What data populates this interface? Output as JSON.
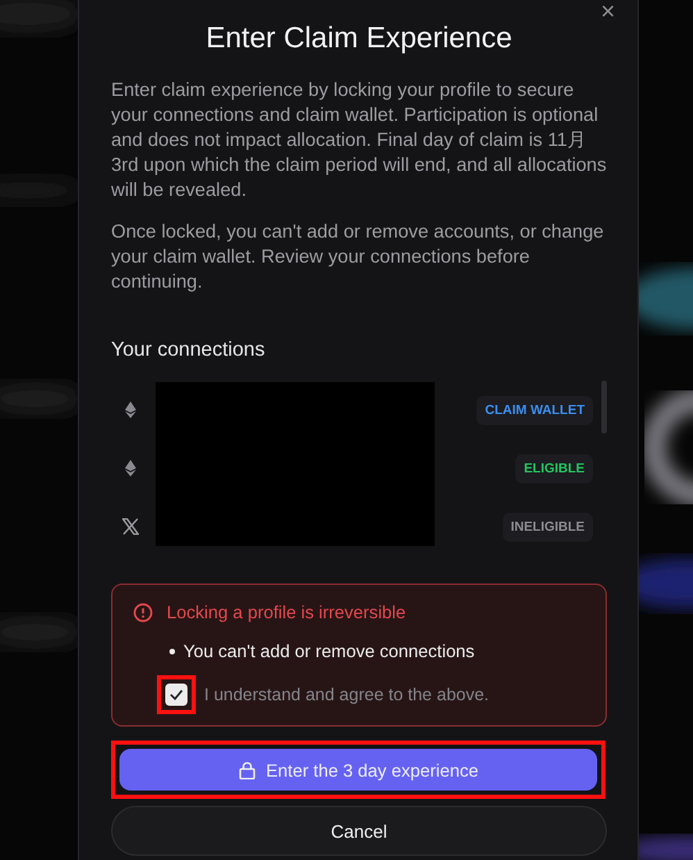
{
  "dialog": {
    "title": "Enter Claim Experience",
    "close": "×",
    "paragraphs": [
      "Enter claim experience by locking your profile to secure your connections and claim wallet. Participation is optional and does not impact allocation. Final day of claim is 11月 3rd upon which the claim period will end, and all allocations will be revealed.",
      "Once locked, you can't add or remove accounts, or change your claim wallet. Review your connections before continuing."
    ],
    "connections_heading": "Your connections",
    "connections": [
      {
        "kind": "ethereum",
        "badge": "CLAIM WALLET",
        "color": "#3b8ef0"
      },
      {
        "kind": "ethereum",
        "badge": "ELIGIBLE",
        "color": "#22c55e"
      },
      {
        "kind": "x",
        "badge": "INELIGIBLE",
        "color": "#8b8b90"
      }
    ],
    "warning": {
      "title": "Locking a profile is irreversible",
      "bullets": [
        "You can't add or remove connections"
      ],
      "agree_label": "I understand and agree to the above.",
      "checked": true,
      "highlighted": true
    },
    "primary_button": {
      "label": "Enter the 3 day experience",
      "highlighted": true
    },
    "cancel_button": {
      "label": "Cancel"
    }
  }
}
